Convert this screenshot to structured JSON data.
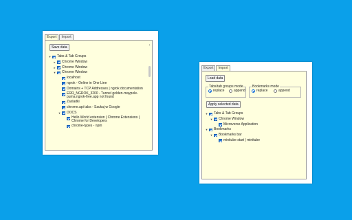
{
  "export_window": {
    "tabs": [
      "Export",
      "Import"
    ],
    "save_button": "Save data",
    "tree": [
      {
        "label": "Tabs & Tab Groups",
        "indent": 0,
        "expander": "▾"
      },
      {
        "label": "Chrome Window",
        "indent": 1,
        "expander": "▸"
      },
      {
        "label": "Chrome Window",
        "indent": 1,
        "expander": "▸"
      },
      {
        "label": "Chrome Window",
        "indent": 1,
        "expander": "▾"
      },
      {
        "label": "localhost",
        "indent": 2,
        "expander": ""
      },
      {
        "label": "ngrok - Online in One Line",
        "indent": 2,
        "expander": ""
      },
      {
        "label": "Domains + TCP Addresses | ngrok documentation",
        "indent": 2,
        "expander": ""
      },
      {
        "label": "ERR_NGROK_3200 - Tunnel golden-maypole-puma.ngrok-free.app not found",
        "indent": 2,
        "expander": "",
        "two": true
      },
      {
        "label": "Zaxladki",
        "indent": 2,
        "expander": ""
      },
      {
        "label": "chrome.api tabs - Szukaj w Google",
        "indent": 2,
        "expander": ""
      },
      {
        "label": "DOCS",
        "indent": 2,
        "expander": "▾"
      },
      {
        "label": "Hello World extension  |  Chrome Extensions  |  Chrome for Developers",
        "indent": 3,
        "expander": "",
        "two": true
      },
      {
        "label": "chrome-types - npm",
        "indent": 3,
        "expander": ""
      }
    ]
  },
  "import_window": {
    "tabs": [
      "Export",
      "Import"
    ],
    "load_button": "Load data",
    "tab_groups_mode": {
      "legend": "Tabs/tab groups mode",
      "options": [
        "replace",
        "append"
      ],
      "selected": "replace"
    },
    "bookmarks_mode": {
      "legend": "Bookmarks mode",
      "options": [
        "replace",
        "append"
      ],
      "selected": "replace"
    },
    "apply_button": "Apply selected data",
    "tree": [
      {
        "label": "Tabs & Tab Groups",
        "indent": 0,
        "expander": "▾"
      },
      {
        "label": "Chrome Window",
        "indent": 1,
        "expander": "▾"
      },
      {
        "label": "Microverse Application",
        "indent": 2,
        "expander": ""
      },
      {
        "label": "Bookmarks",
        "indent": 0,
        "expander": "▾"
      },
      {
        "label": "Bookmarks bar",
        "indent": 1,
        "expander": "▾"
      },
      {
        "label": "minitube start | minitube",
        "indent": 2,
        "expander": ""
      }
    ]
  },
  "colors": {
    "desktop": "#0aa0ea",
    "panel": "#ffffde",
    "checkbox": "#2175d9"
  }
}
